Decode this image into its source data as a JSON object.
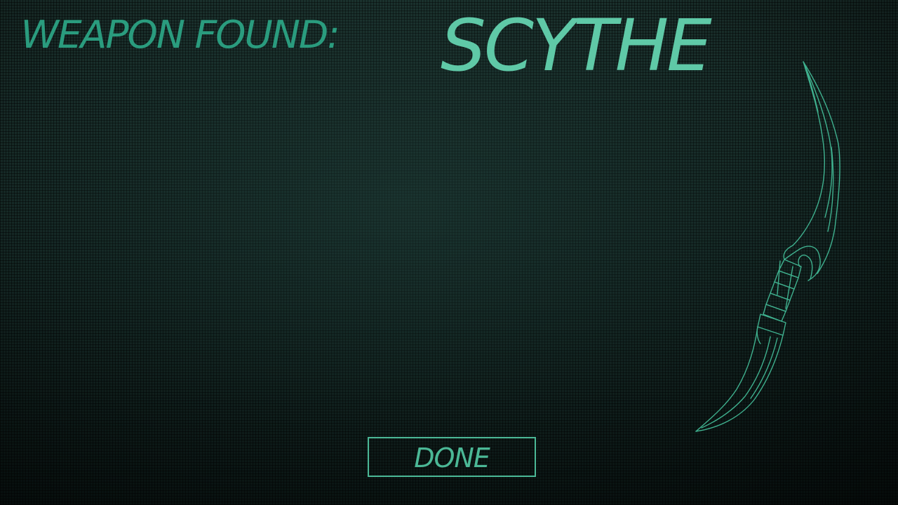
{
  "header": {
    "label": "WEAPON FOUND:",
    "weapon_name": "SCYTHE"
  },
  "weapon_art": {
    "icon": "scythe-blade-sketch-icon",
    "stroke_color": "#3fb08e"
  },
  "actions": {
    "done_label": "DONE"
  },
  "colors": {
    "label": "#2a9c7e",
    "title": "#5fc9a7",
    "button": "#4bb896",
    "background": "#142724"
  }
}
